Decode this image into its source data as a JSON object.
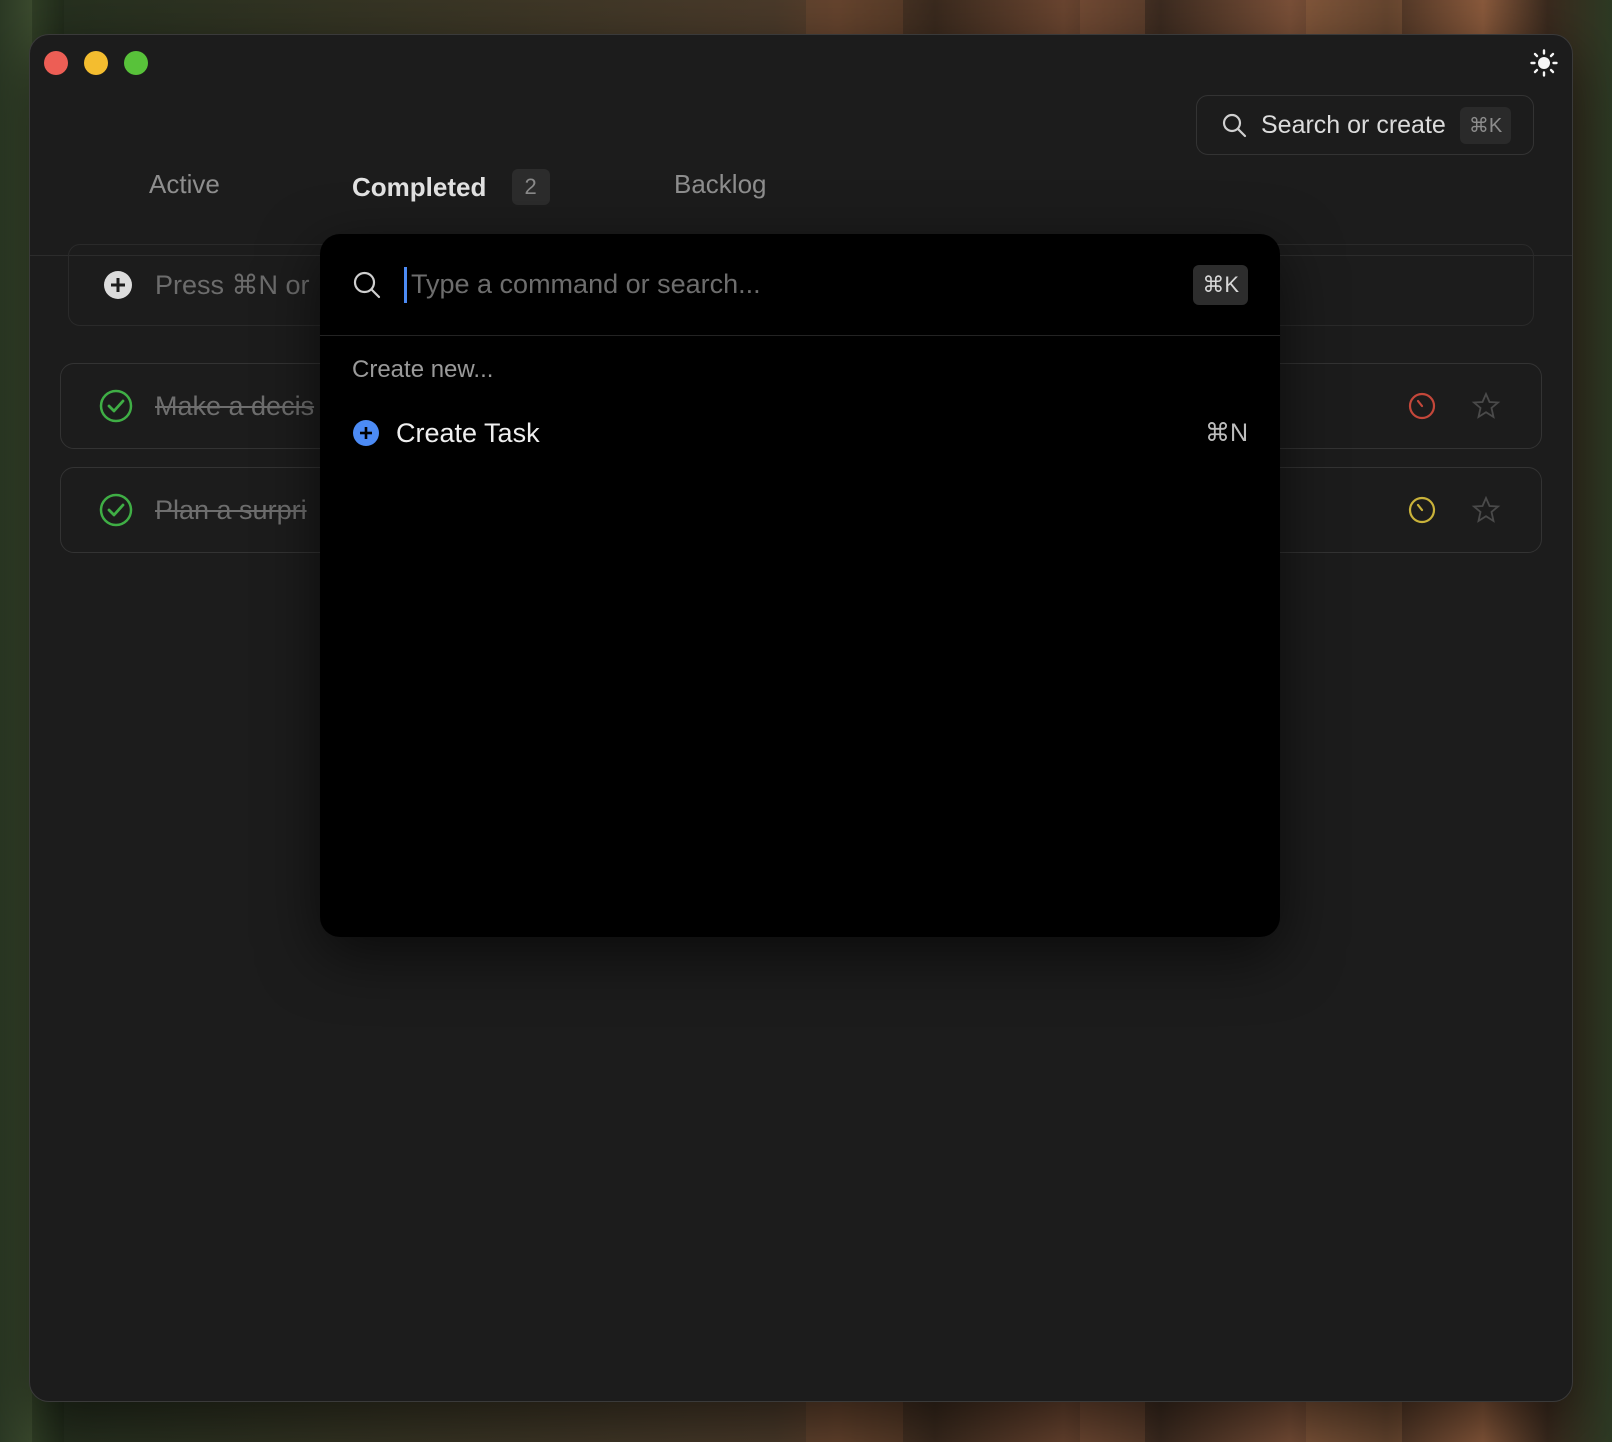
{
  "window": {
    "traffic_lights": [
      "close",
      "minimize",
      "zoom"
    ],
    "theme_toggle_icon": "sun-icon"
  },
  "tabs": [
    {
      "label": "Active"
    },
    {
      "label": "Completed",
      "count": "2"
    },
    {
      "label": "Backlog"
    }
  ],
  "header_search": {
    "label": "Search or create",
    "shortcut": "⌘K"
  },
  "new_task": {
    "placeholder": "Press ⌘N or"
  },
  "tasks": [
    {
      "title": "Make a decis",
      "timer_color": "#c4473a"
    },
    {
      "title": "Plan a surpri",
      "timer_color": "#c9b23a"
    }
  ],
  "palette": {
    "placeholder": "Type a command or search...",
    "shortcut": "⌘K",
    "section_label": "Create new...",
    "items": [
      {
        "label": "Create Task",
        "shortcut": "⌘N",
        "icon": "plus-circle-icon"
      }
    ]
  },
  "colors": {
    "accent": "#4c8bf5",
    "done": "#3fae45"
  }
}
